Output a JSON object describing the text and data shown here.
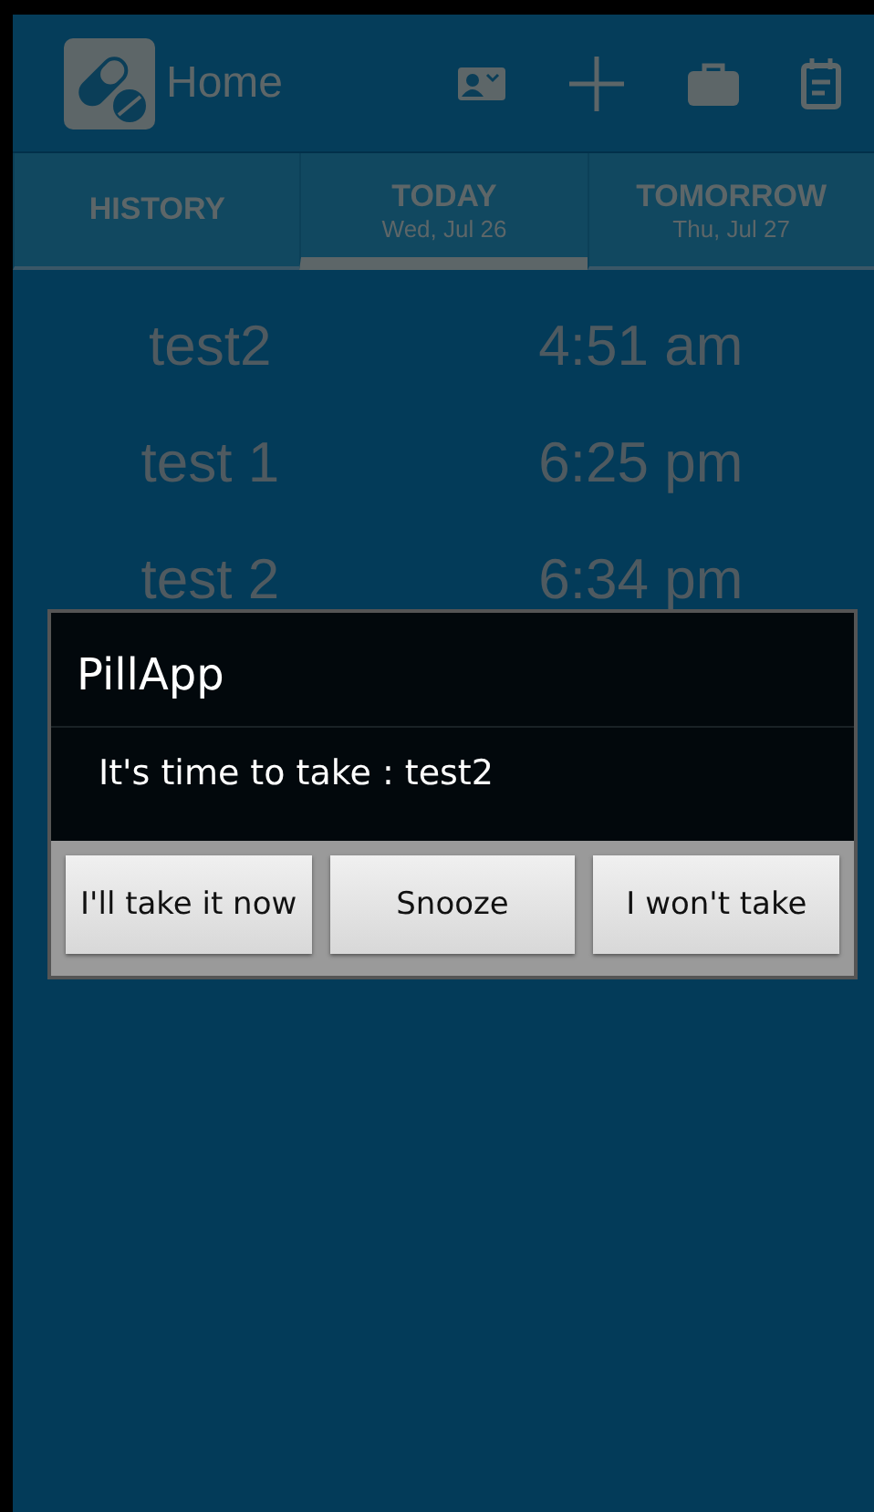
{
  "app_bar": {
    "title": "Home"
  },
  "tabs": [
    {
      "label": "HISTORY",
      "selected": false
    },
    {
      "label": "TODAY",
      "sublabel": "Wed, Jul 26",
      "selected": true
    },
    {
      "label": "TOMORROW",
      "sublabel": "Thu, Jul 27",
      "selected": false
    }
  ],
  "schedule": [
    {
      "name": "test2",
      "time": "4:51 am"
    },
    {
      "name": "test 1",
      "time": "6:25 pm"
    },
    {
      "name": "test 2",
      "time": "6:34 pm"
    }
  ],
  "dialog": {
    "title": "PillApp",
    "message": "It's time to take : test2",
    "buttons": [
      "I'll take it now",
      "Snooze",
      "I won't take"
    ]
  }
}
